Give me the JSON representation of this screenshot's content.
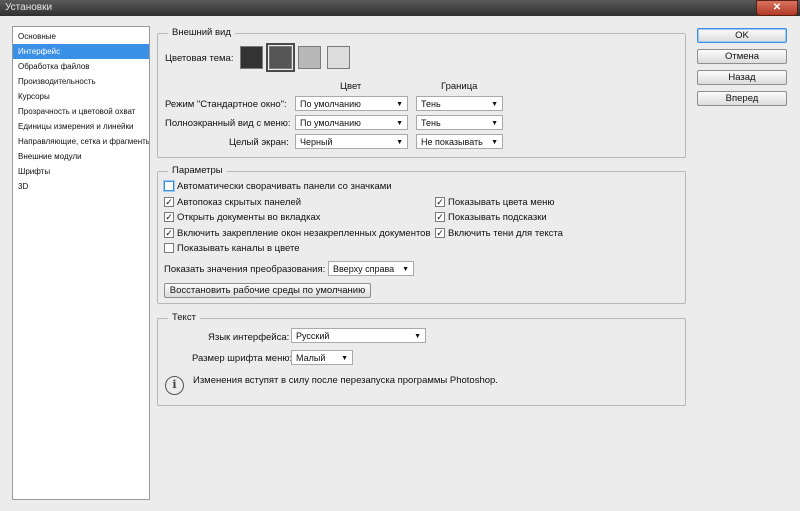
{
  "window": {
    "title": "Установки",
    "close_glyph": "✕"
  },
  "sidebar": {
    "items": [
      "Основные",
      "Интерфейс",
      "Обработка файлов",
      "Производительность",
      "Курсоры",
      "Прозрачность и цветовой охват",
      "Единицы измерения и линейки",
      "Направляющие, сетка и фрагменты",
      "Внешние модули",
      "Шрифты",
      "3D"
    ],
    "selected_index": 1
  },
  "appearance": {
    "legend": "Внешний вид",
    "theme_label": "Цветовая тема:",
    "theme_swatches": [
      "#333333",
      "#555555",
      "#b8b8b8",
      "#dcdcdc"
    ],
    "selected_swatch": 1,
    "col_color": "Цвет",
    "col_border": "Граница",
    "rows": [
      {
        "label": "Режим \"Стандартное окно\":",
        "color": "По умолчанию",
        "border": "Тень"
      },
      {
        "label": "Полноэкранный вид с меню:",
        "color": "По умолчанию",
        "border": "Тень"
      },
      {
        "label": "Целый экран:",
        "color": "Черный",
        "border": "Не показывать"
      }
    ]
  },
  "params": {
    "legend": "Параметры",
    "auto_collapse": {
      "label": "Автоматически сворачивать панели со значками",
      "checked": false
    },
    "left": [
      {
        "label": "Автопоказ скрытых панелей",
        "checked": true
      },
      {
        "label": "Открыть документы во вкладках",
        "checked": true
      },
      {
        "label": "Включить закрепление окон незакрепленных документов",
        "checked": true
      },
      {
        "label": "Показывать каналы в цвете",
        "checked": false
      }
    ],
    "right": [
      {
        "label": "Показывать цвета меню",
        "checked": true
      },
      {
        "label": "Показывать подсказки",
        "checked": true
      },
      {
        "label": "Включить тени для текста",
        "checked": true
      }
    ],
    "transform_label": "Показать значения преобразования:",
    "transform_value": "Вверху справа",
    "restore_button": "Восстановить рабочие среды по умолчанию"
  },
  "text_group": {
    "legend": "Текст",
    "lang_label": "Язык интерфейса:",
    "lang_value": "Русский",
    "font_label": "Размер шрифта меню:",
    "font_value": "Малый",
    "info": "Изменения вступят в силу после перезапуска программы Photoshop."
  },
  "buttons": {
    "ok": "OK",
    "cancel": "Отмена",
    "back": "Назад",
    "forward": "Вперед"
  },
  "colors": {
    "accent": "#3a8fe6"
  }
}
